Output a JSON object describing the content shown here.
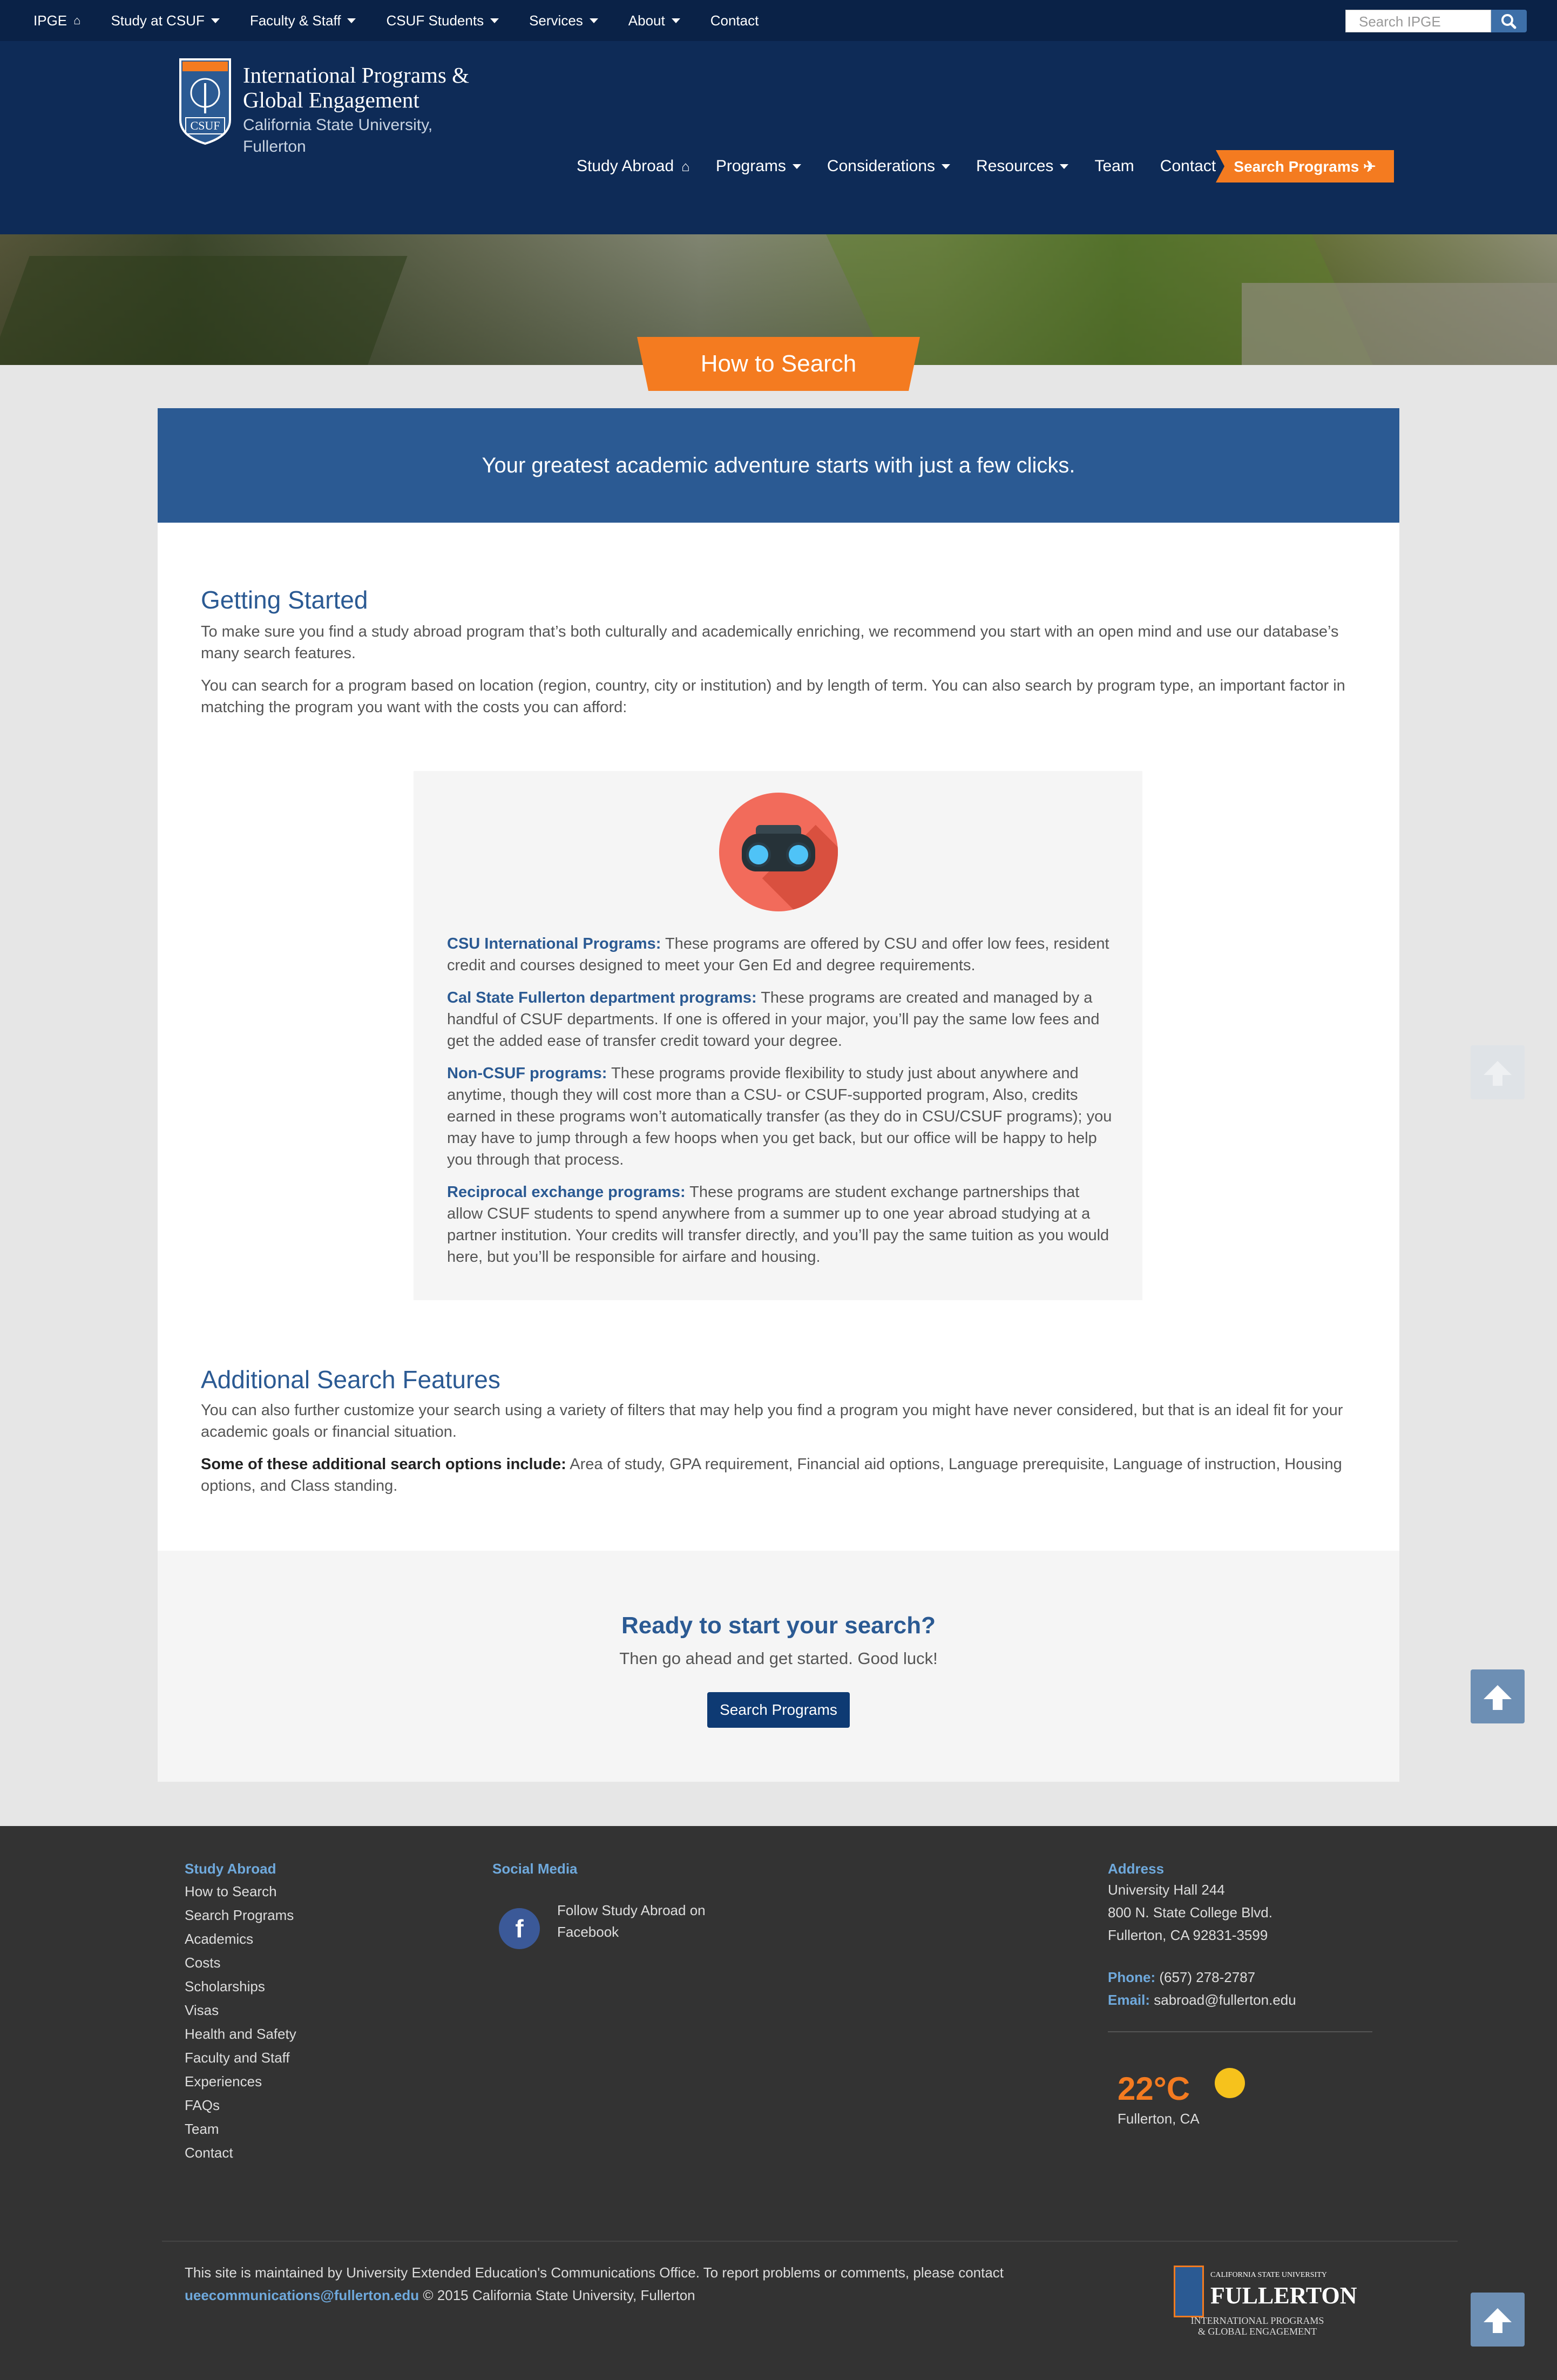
{
  "topbar": {
    "items": [
      {
        "label": "IPGE",
        "icon": "home-icon"
      },
      {
        "label": "Study at CSUF",
        "dropdown": true
      },
      {
        "label": "Faculty & Staff",
        "dropdown": true
      },
      {
        "label": "CSUF Students",
        "dropdown": true
      },
      {
        "label": "Services",
        "dropdown": true
      },
      {
        "label": "About",
        "dropdown": true
      },
      {
        "label": "Contact"
      }
    ],
    "search_placeholder": "Search IPGE"
  },
  "header": {
    "title": "International Programs & Global Engagement",
    "subtitle": "California State University, Fullerton",
    "seal_text": "CSUF",
    "nav": [
      {
        "label": "Study Abroad",
        "icon": "home-icon"
      },
      {
        "label": "Programs",
        "dropdown": true
      },
      {
        "label": "Considerations",
        "dropdown": true
      },
      {
        "label": "Resources",
        "dropdown": true
      },
      {
        "label": "Team"
      },
      {
        "label": "Contact"
      }
    ],
    "search_button": "Search Programs ✈"
  },
  "page": {
    "tab_title": "How to Search",
    "intro": "Your greatest academic adventure starts with just a few clicks.",
    "getting_started": {
      "heading": "Getting Started",
      "p1": "To make sure you find a study abroad program that’s both culturally and academically enriching, we recommend you start with an open mind and use our database’s many search features.",
      "p2": "You can search for a program based on location (region, country, city or institution) and by length of term. You can also search by program type, an important factor in matching the program you want with the costs you can afford:"
    },
    "program_types": [
      {
        "key": "CSU International Programs:",
        "text": " These programs are offered by CSU and offer low fees, resident credit and courses designed to meet your Gen Ed and degree requirements."
      },
      {
        "key": "Cal State Fullerton department programs:",
        "text": " These programs are created and managed by a handful of CSUF departments. If one is offered in your major, you’ll pay the same low fees and get the added ease of transfer credit toward your degree."
      },
      {
        "key": "Non-CSUF programs:",
        "text": " These programs provide flexibility to study just about anywhere and anytime, though they will cost more than a CSU- or CSUF-supported program, Also, credits earned in these programs won’t automatically transfer (as they do in CSU/CSUF programs); you may have to jump through a few hoops when you get back, but our office will be happy to help you through that process."
      },
      {
        "key": "Reciprocal exchange programs:",
        "text": " These programs are student exchange partnerships that allow CSUF students to spend anywhere from a summer up to one year abroad studying at a partner institution. Your credits will transfer directly, and you’ll pay the same tuition as you would here, but you’ll be responsible for airfare and housing."
      }
    ],
    "additional": {
      "heading": "Additional Search Features",
      "p1": "You can also further customize your search using a variety of filters that may help you find a program you might have never considered, but that is an ideal fit for your academic goals or financial situation.",
      "p2_label": "Some of these additional search options include:",
      "p2_text": " Area of study, GPA requirement, Financial aid options, Language prerequisite, Language of instruction, Housing options, and Class standing."
    },
    "cta": {
      "title": "Ready to start your search?",
      "subtitle": "Then go ahead and get started. Good luck!",
      "button": "Search Programs"
    }
  },
  "footer": {
    "study_abroad": {
      "heading": "Study Abroad",
      "links": [
        "How to Search",
        "Search Programs",
        "Academics",
        "Costs",
        "Scholarships",
        "Visas",
        "Health and Safety",
        "Faculty and Staff",
        "Experiences",
        "FAQs",
        "Team",
        "Contact"
      ]
    },
    "social": {
      "heading": "Social Media",
      "facebook_text": "Follow Study Abroad on Facebook"
    },
    "address": {
      "heading": "Address",
      "lines": [
        "University Hall 244",
        "800 N. State College Blvd.",
        "Fullerton, CA 92831-3599"
      ],
      "phone_label": "Phone:",
      "phone": " (657) 278-2787",
      "email_label": "Email:",
      "email": " sabroad@fullerton.edu"
    },
    "weather": {
      "temp": "22°C",
      "location": "Fullerton, CA"
    },
    "note_text": "This site is maintained by University Extended Education's Communications Office. To report problems or comments, please contact ",
    "note_email": "ueecommunications@fullerton.edu",
    "note_copy": " © 2015 California State University, Fullerton",
    "logo": {
      "csu": "CALIFORNIA STATE UNIVERSITY",
      "name": "FULLERTON",
      "ipge_line1": "INTERNATIONAL PROGRAMS",
      "ipge_line2": "& GLOBAL ENGAGEMENT"
    }
  },
  "colors": {
    "navy": "#0e2b57",
    "blue": "#2b5a93",
    "orange": "#f47b20",
    "footer": "#333333"
  }
}
